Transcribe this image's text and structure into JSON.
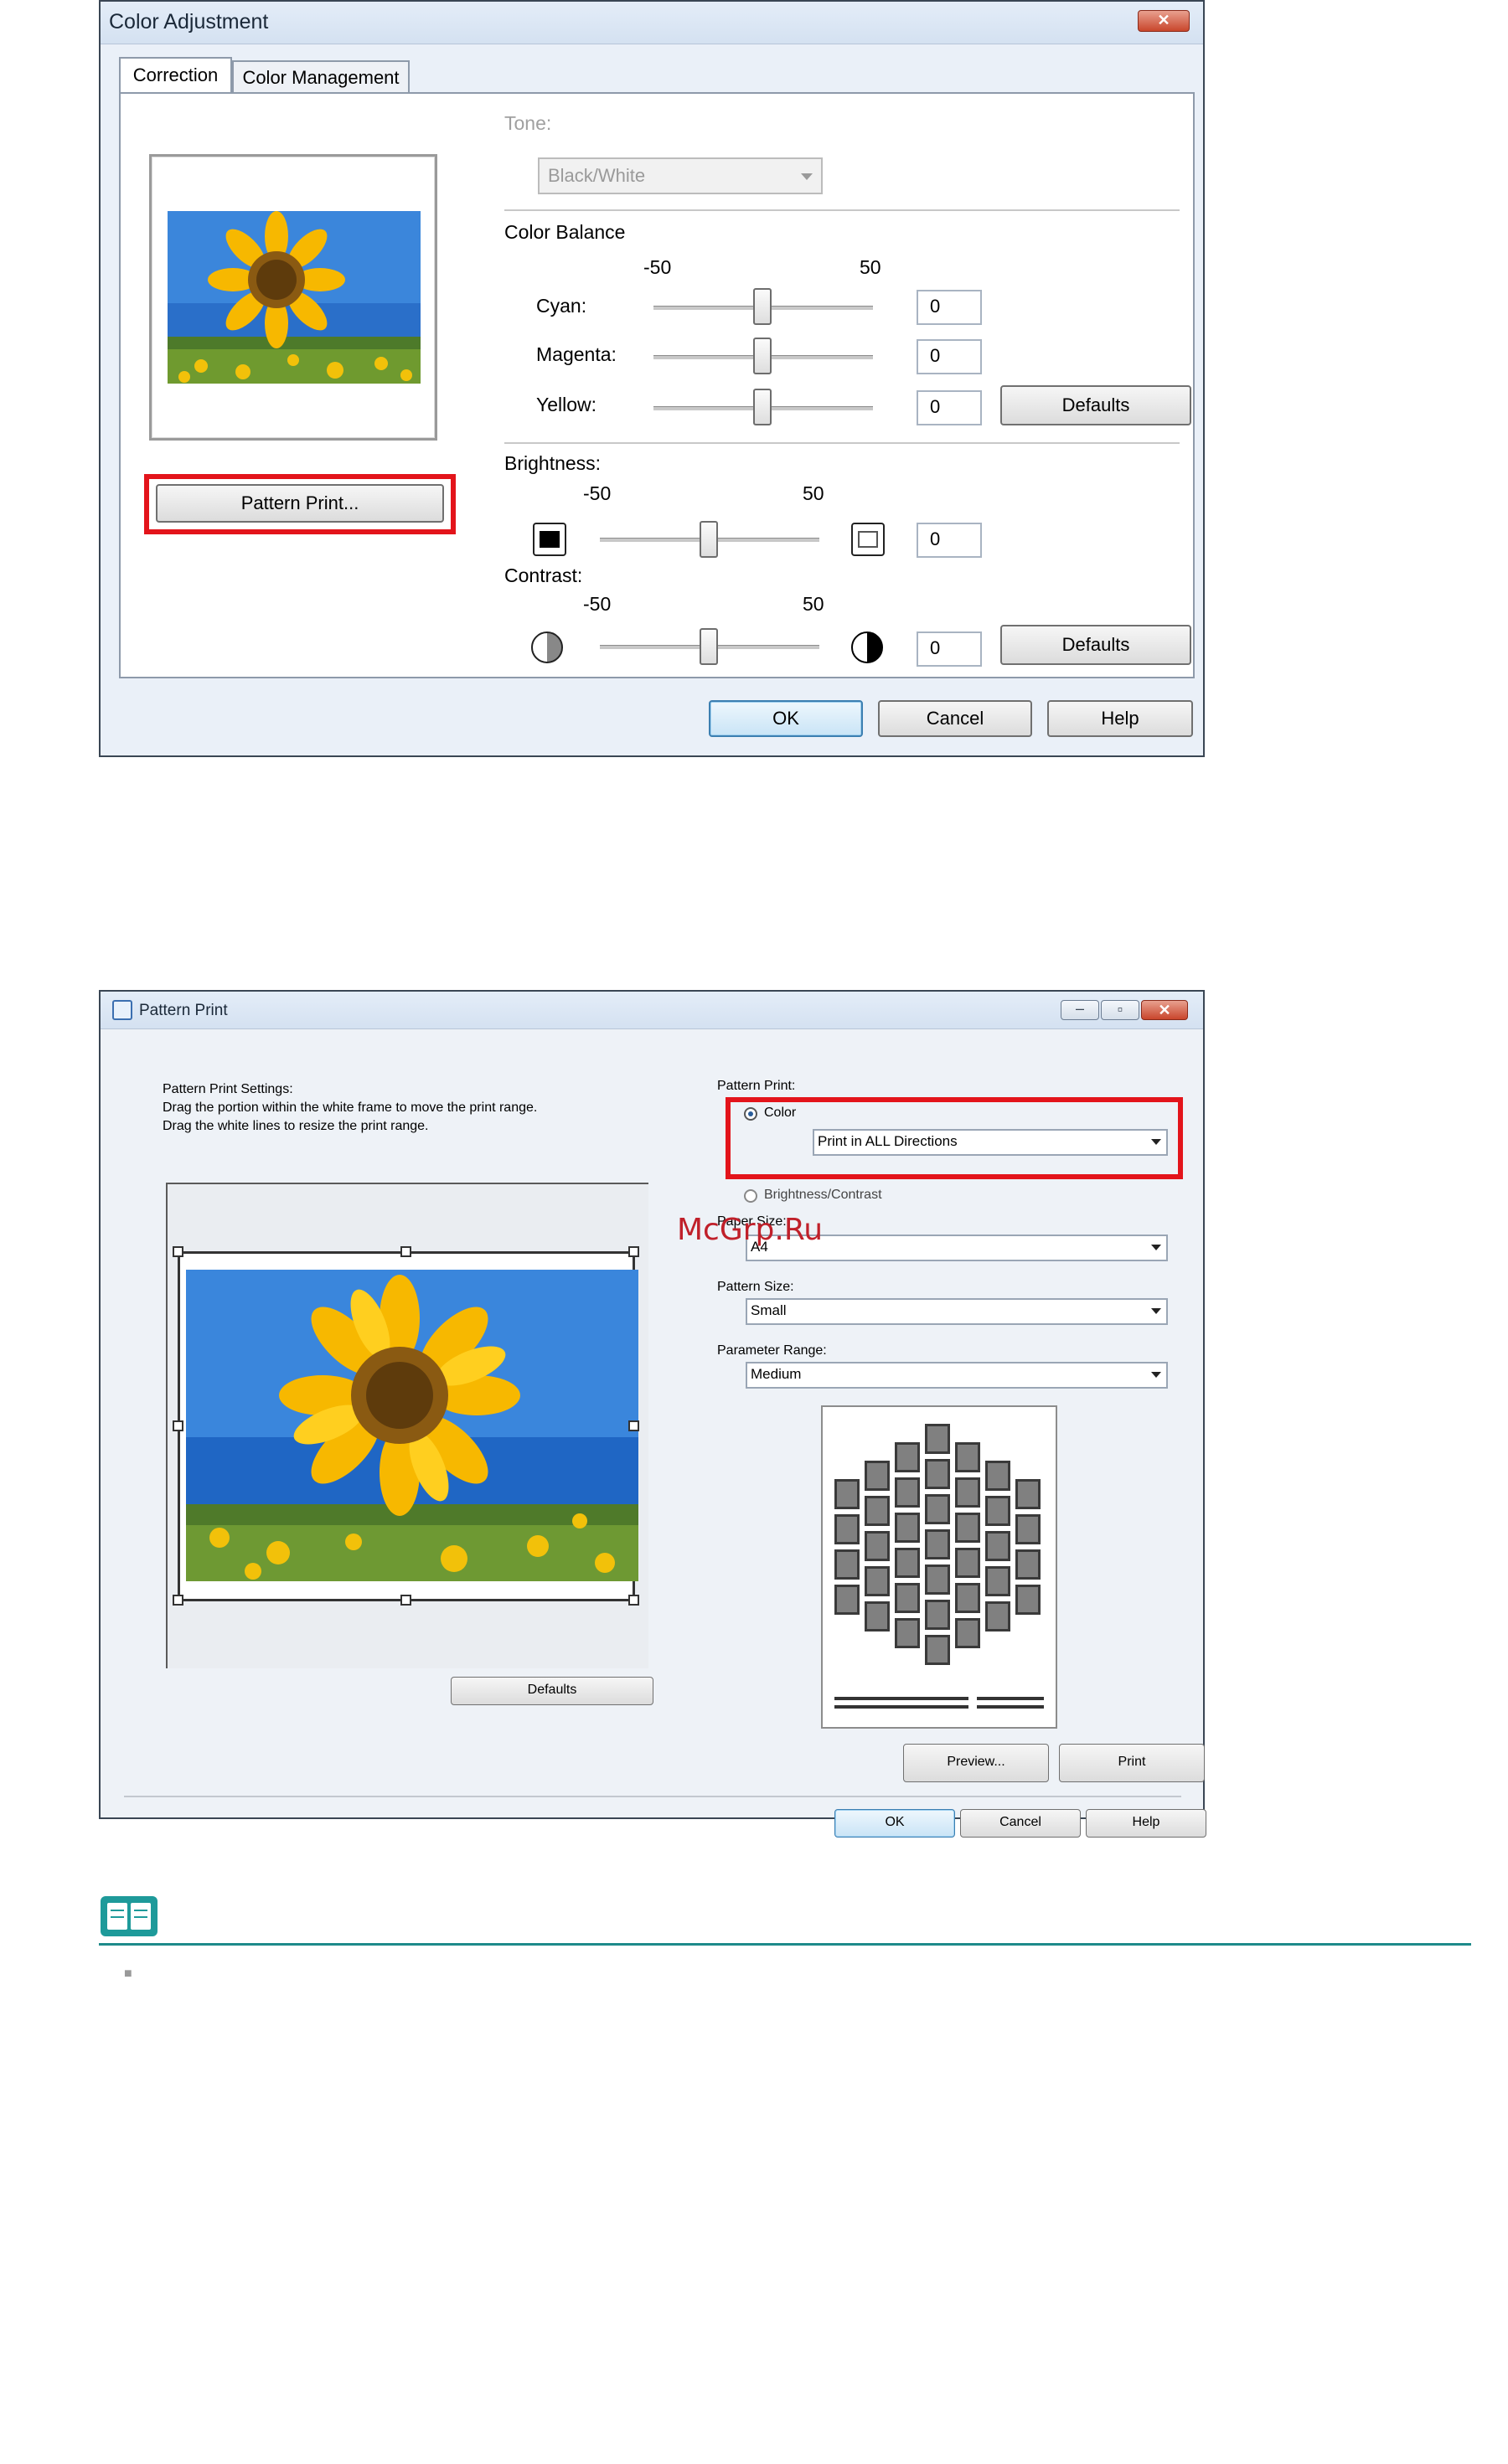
{
  "color_adjustment": {
    "title": "Color Adjustment",
    "close_glyph": "✕",
    "tabs": [
      "Correction",
      "Color Management"
    ],
    "tone_label": "Tone:",
    "tone_value": "Black/White",
    "color_balance_label": "Color Balance",
    "scale_min": "-50",
    "scale_max": "50",
    "cyan_label": "Cyan:",
    "cyan_value": "0",
    "magenta_label": "Magenta:",
    "magenta_value": "0",
    "yellow_label": "Yellow:",
    "yellow_value": "0",
    "defaults_label": "Defaults",
    "brightness_label": "Brightness:",
    "brightness_value": "0",
    "contrast_label": "Contrast:",
    "contrast_value": "0",
    "pattern_print_button": "Pattern Print...",
    "ok": "OK",
    "cancel": "Cancel",
    "help": "Help"
  },
  "pattern_print": {
    "title": "Pattern Print",
    "settings_lines": [
      "Pattern Print Settings:",
      "Drag the portion within the white frame to move the print range.",
      "Drag the white lines to resize the print range."
    ],
    "pattern_print_label": "Pattern Print:",
    "color_radio": "Color",
    "direction_value": "Print in ALL Directions",
    "brightness_contrast_radio": "Brightness/Contrast",
    "paper_size_label": "Paper Size:",
    "paper_size_value": "A4",
    "pattern_size_label": "Pattern Size:",
    "pattern_size_value": "Small",
    "parameter_range_label": "Parameter Range:",
    "parameter_range_value": "Medium",
    "defaults": "Defaults",
    "preview": "Preview...",
    "print": "Print",
    "ok": "OK",
    "cancel": "Cancel",
    "help": "Help"
  },
  "watermark": "McGrp.Ru",
  "note_bullet": "■",
  "colors": {
    "highlight": "#e3141b",
    "rule": "#1e8a8a",
    "note_icon": "#1e9a9a"
  }
}
